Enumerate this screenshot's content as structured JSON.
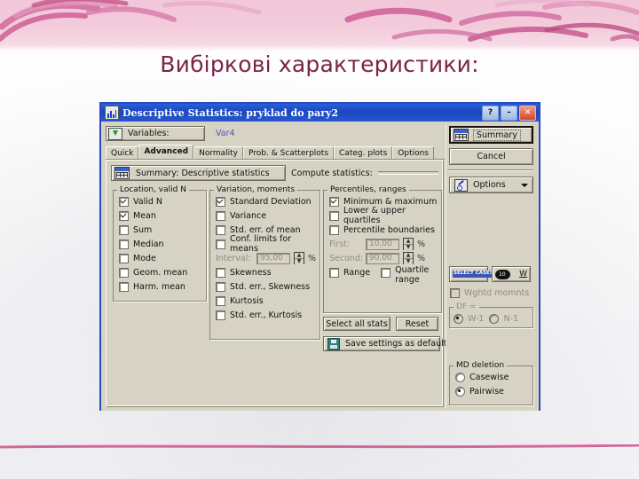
{
  "slide": {
    "title": "Вибіркові характеристики:",
    "title_color": "#7b2349",
    "band_color": "#e8699f"
  },
  "dialog": {
    "title": "Descriptive Statistics: pryklad do pary2",
    "title_icon": "chart-icon",
    "titlebar_buttons": [
      {
        "name": "help-button",
        "label": "?"
      },
      {
        "name": "minimize-button",
        "label": "–"
      },
      {
        "name": "close-button",
        "label": "✕"
      }
    ],
    "variables": {
      "button_label": "Variables:",
      "icon": "variables-icon",
      "value": "Var4",
      "value_color": "#5a4fc2"
    },
    "tabs": [
      {
        "label": "Quick",
        "active": false
      },
      {
        "label": "Advanced",
        "active": true
      },
      {
        "label": "Normality",
        "active": false
      },
      {
        "label": "Prob. & Scatterplots",
        "active": false
      },
      {
        "label": "Categ. plots",
        "active": false
      },
      {
        "label": "Options",
        "active": false
      }
    ],
    "summary_row": {
      "button_label": "Summary: Descriptive statistics",
      "icon": "grid-icon",
      "compute_label": "Compute statistics:"
    },
    "groups": {
      "location": {
        "legend": "Location, valid N",
        "items": [
          {
            "label": "Valid N",
            "checked": true
          },
          {
            "label": "Mean",
            "checked": true
          },
          {
            "label": "Sum",
            "checked": false
          },
          {
            "label": "Median",
            "checked": false
          },
          {
            "label": "Mode",
            "checked": false
          },
          {
            "label": "Geom. mean",
            "checked": false
          },
          {
            "label": "Harm. mean",
            "checked": false
          }
        ]
      },
      "variation": {
        "legend": "Variation, moments",
        "items": [
          {
            "label": "Standard Deviation",
            "checked": true
          },
          {
            "label": "Variance",
            "checked": false
          },
          {
            "label": "Std. err. of mean",
            "checked": false
          },
          {
            "label": "Conf. limits for means",
            "checked": false
          }
        ],
        "interval": {
          "label": "Interval:",
          "value": "95,00",
          "unit": "%",
          "disabled": true
        },
        "items2": [
          {
            "label": "Skewness",
            "checked": false
          },
          {
            "label": "Std. err., Skewness",
            "checked": false
          },
          {
            "label": "Kurtosis",
            "checked": false
          },
          {
            "label": "Std. err., Kurtosis",
            "checked": false
          }
        ]
      },
      "percentiles": {
        "legend": "Percentiles, ranges",
        "items": [
          {
            "label": "Minimum & maximum",
            "checked": true
          },
          {
            "label": "Lower & upper quartiles",
            "checked": false
          },
          {
            "label": "Percentile boundaries",
            "checked": false
          }
        ],
        "first": {
          "label": "First:",
          "value": "10,00",
          "unit": "%",
          "disabled": true
        },
        "second": {
          "label": "Second:",
          "value": "90,00",
          "unit": "%",
          "disabled": true
        },
        "range": {
          "label": "Range",
          "checked": false
        },
        "quartile_range": {
          "label": "Quartile",
          "label2": "range",
          "checked": false
        }
      }
    },
    "actions": {
      "select_all": "Select all stats",
      "reset": "Reset",
      "save_default": "Save settings as default",
      "save_icon": "floppy-icon"
    },
    "right": {
      "summary": {
        "label": "Summary",
        "icon": "grid-icon"
      },
      "cancel": "Cancel",
      "options": {
        "label": "Options",
        "icon": "wrench-icon",
        "caret": "chevron-down-icon"
      },
      "select_cases": {
        "tag": "SELECT CASES",
        "letter": "S",
        "name": "select-cases-button"
      },
      "weight": {
        "letter": "W",
        "icon": "weight-icon",
        "name": "weight-button"
      },
      "weighted_moments": {
        "label": "Wghtd momnts",
        "checked": false,
        "disabled": true
      },
      "df": {
        "legend": "DF =",
        "options": [
          {
            "label": "W-1",
            "selected": true,
            "disabled": true
          },
          {
            "label": "N-1",
            "selected": false,
            "disabled": true
          }
        ]
      },
      "md_deletion": {
        "legend": "MD deletion",
        "options": [
          {
            "label": "Casewise",
            "selected": false
          },
          {
            "label": "Pairwise",
            "selected": true
          }
        ]
      }
    }
  }
}
